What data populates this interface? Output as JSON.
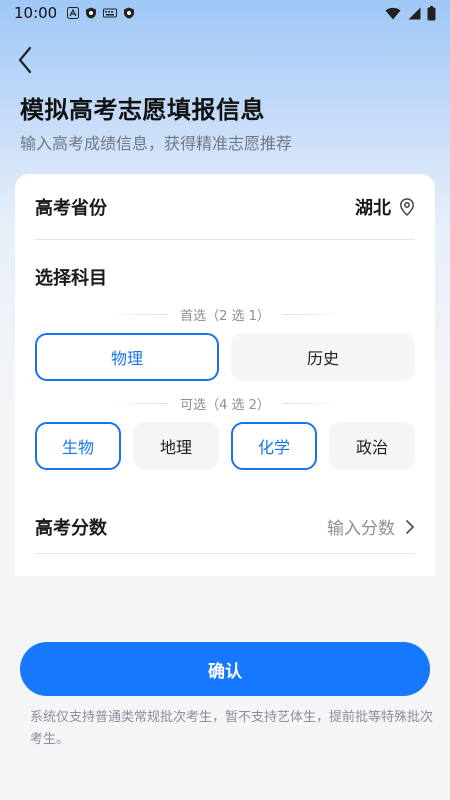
{
  "status_bar": {
    "time": "10:00",
    "left_icons": [
      "a-icon",
      "shield-icon",
      "keyboard-icon",
      "shield-icon"
    ],
    "right_icons": [
      "wifi-icon",
      "signal-icon",
      "battery-icon"
    ]
  },
  "header": {
    "back_icon": "chevron-left-icon",
    "title": "模拟高考志愿填报信息",
    "subtitle": "输入高考成绩信息，获得精准志愿推荐"
  },
  "form": {
    "province": {
      "label": "高考省份",
      "value": "湖北",
      "icon": "location-pin-icon"
    },
    "subjects": {
      "title": "选择科目",
      "primary": {
        "label": "首选（2 选 1）",
        "options": [
          {
            "label": "物理",
            "selected": true
          },
          {
            "label": "历史",
            "selected": false
          }
        ]
      },
      "secondary": {
        "label": "可选（4 选 2）",
        "options": [
          {
            "label": "生物",
            "selected": true
          },
          {
            "label": "地理",
            "selected": false
          },
          {
            "label": "化学",
            "selected": true
          },
          {
            "label": "政治",
            "selected": false
          }
        ]
      }
    },
    "score": {
      "label": "高考分数",
      "placeholder": "输入分数",
      "icon": "chevron-right-icon"
    }
  },
  "footer": {
    "confirm_label": "确认",
    "notice": "系统仅支持普通类常规批次考生，暂不支持艺体生，提前批等特殊批次考生。"
  },
  "colors": {
    "accent": "#1677ff",
    "selected_border": "#1a73e8",
    "muted_text": "#8a8f99"
  }
}
